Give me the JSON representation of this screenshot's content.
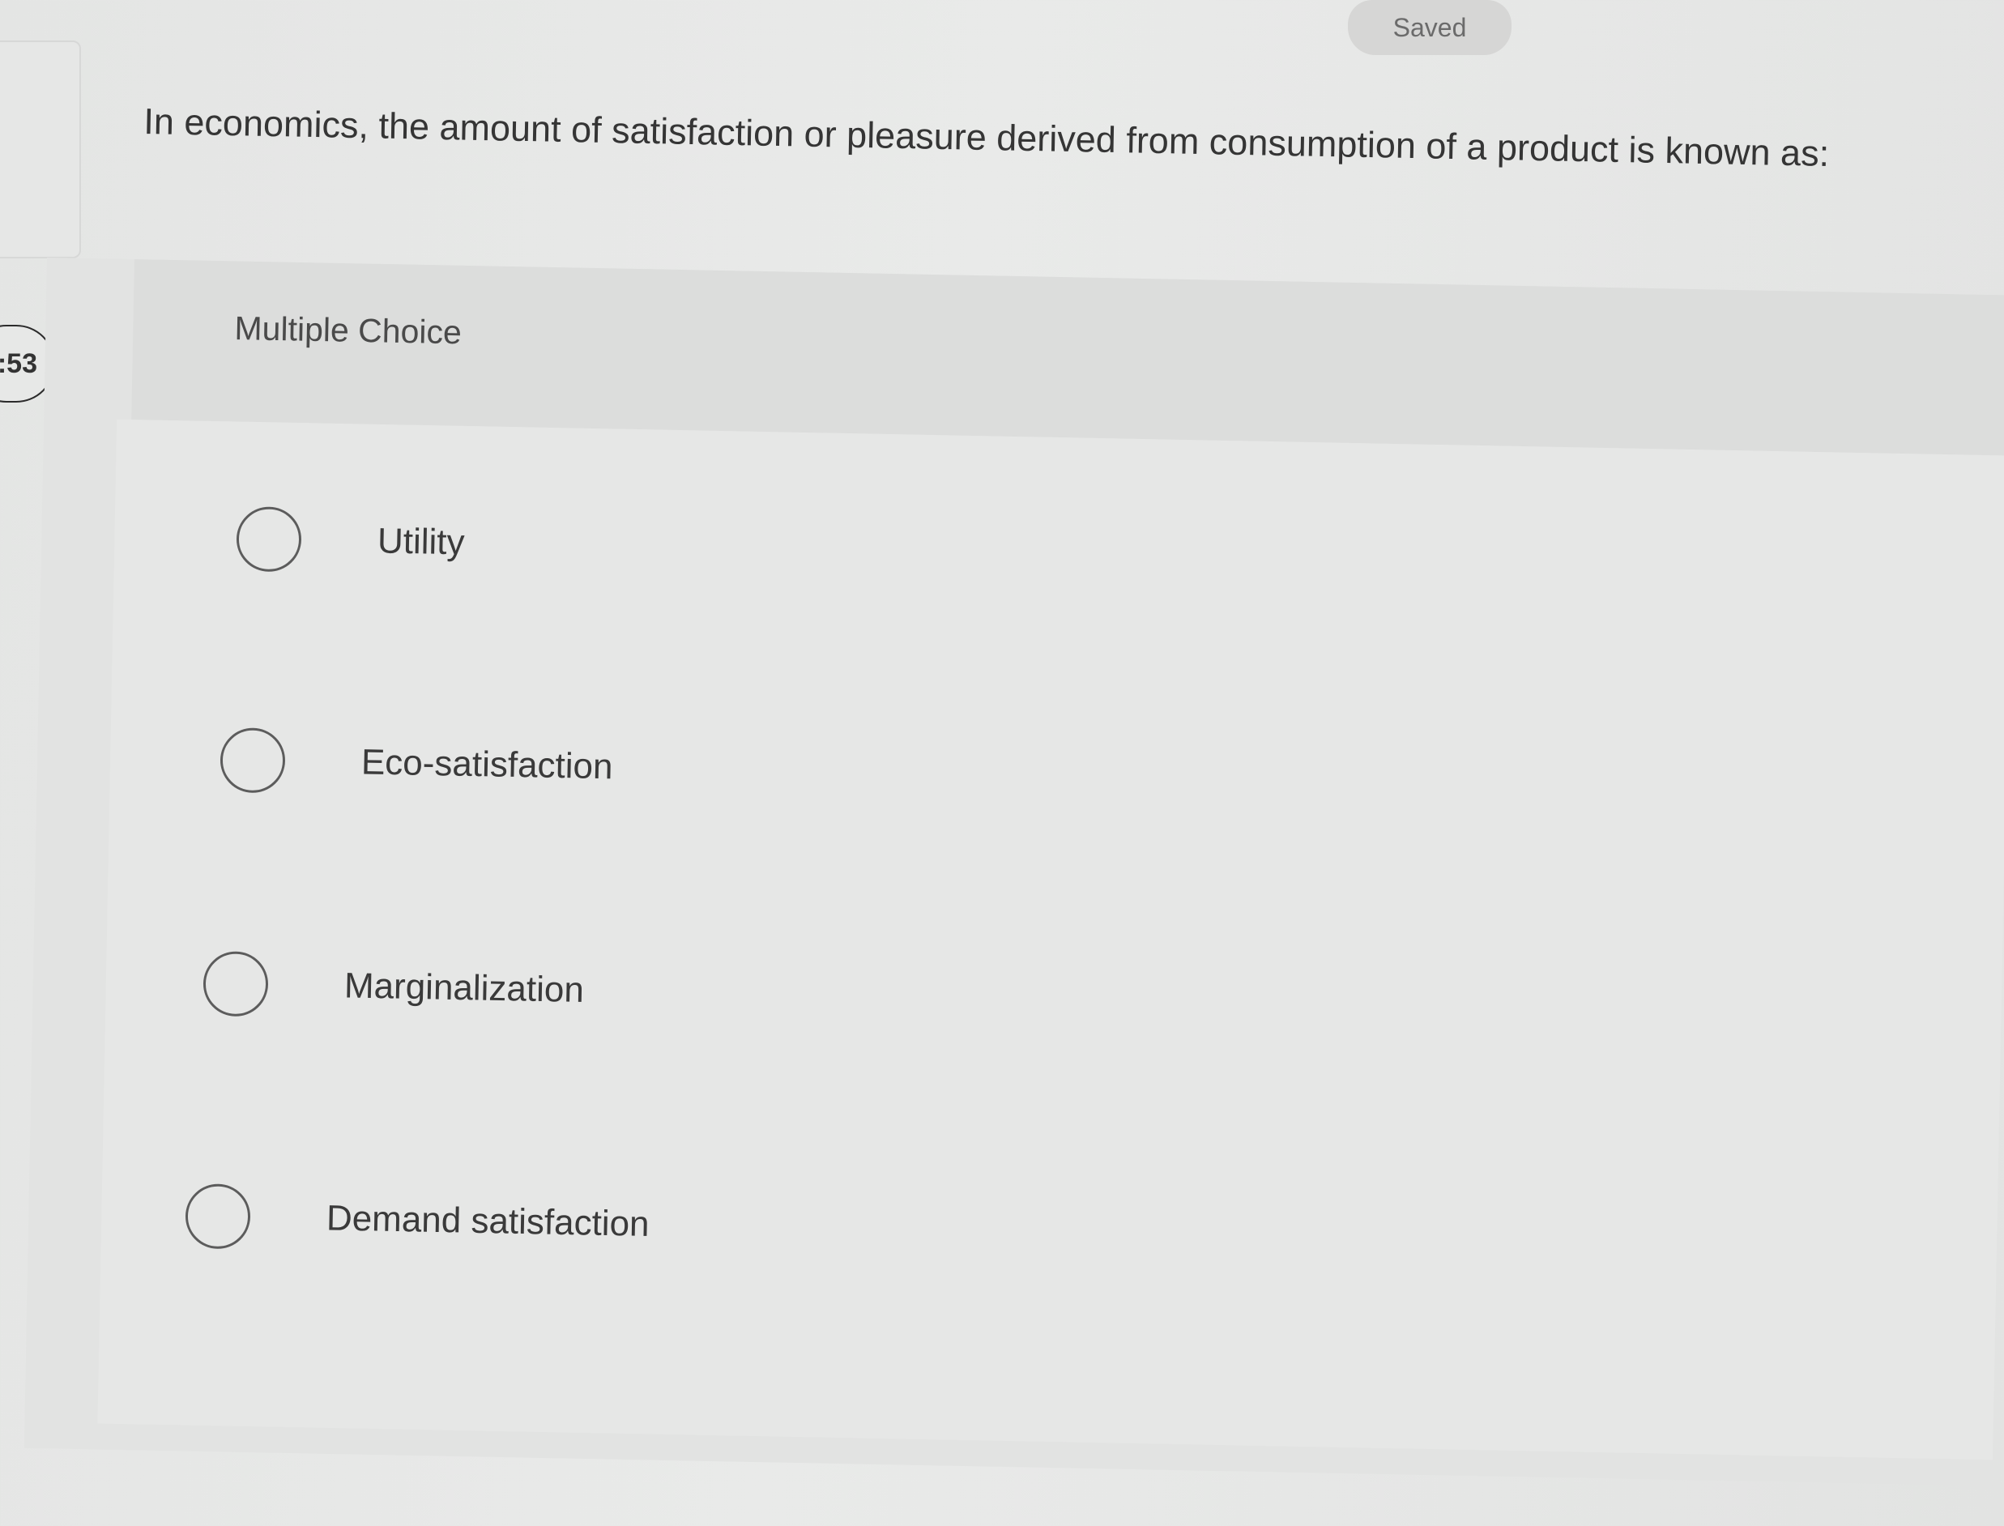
{
  "status": {
    "saved_label": "Saved"
  },
  "timer": {
    "text": ":53"
  },
  "question": {
    "text": "In economics, the amount of satisfaction or pleasure derived from consumption of a product is known as:"
  },
  "answer_block": {
    "type_label": "Multiple Choice",
    "options": [
      {
        "label": "Utility",
        "selected": false
      },
      {
        "label": "Eco-satisfaction",
        "selected": false
      },
      {
        "label": "Marginalization",
        "selected": false
      },
      {
        "label": "Demand satisfaction",
        "selected": false
      }
    ]
  },
  "colors": {
    "background": "#e6e7e6",
    "text": "#353535",
    "saved_pill": "#d6d6d5",
    "radio_border": "#5c5c5c"
  }
}
